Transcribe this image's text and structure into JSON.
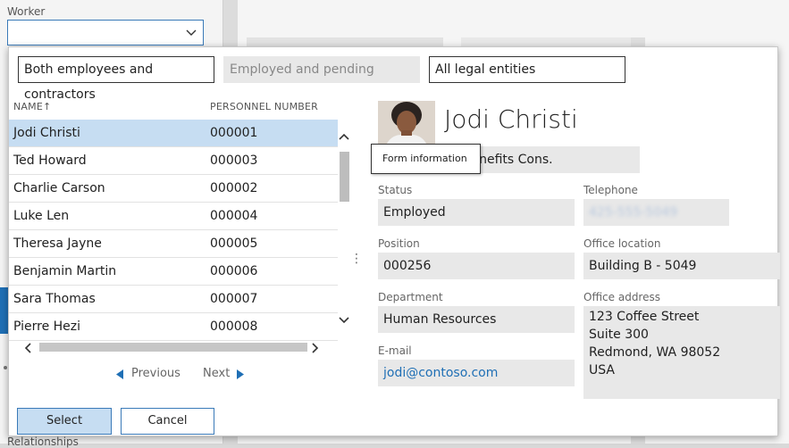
{
  "background": {
    "worker_label": "Worker",
    "bottom_text": "Relationships"
  },
  "filters": {
    "worker_type": "Both employees and contractors",
    "employment_status": "Employed and pending",
    "legal_entity": "All legal entities"
  },
  "grid": {
    "columns": {
      "name": "NAME",
      "name_sort_arrow": "↑",
      "personnel_number": "PERSONNEL NUMBER"
    },
    "rows": [
      {
        "name": "Jodi Christi",
        "number": "000001",
        "selected": true
      },
      {
        "name": "Ted Howard",
        "number": "000003"
      },
      {
        "name": "Charlie Carson",
        "number": "000002"
      },
      {
        "name": "Luke Len",
        "number": "000004"
      },
      {
        "name": "Theresa Jayne",
        "number": "000005"
      },
      {
        "name": "Benjamin Martin",
        "number": "000006"
      },
      {
        "name": "Sara Thomas",
        "number": "000007"
      },
      {
        "name": "Pierre Hezi",
        "number": "000008"
      }
    ]
  },
  "pager": {
    "previous": "Previous",
    "next": "Next"
  },
  "buttons": {
    "select": "Select",
    "cancel": "Cancel"
  },
  "details": {
    "name": "Jodi Christi",
    "job_title": "Compensation & Benefits Cons.",
    "tooltip": "Form information",
    "status_label": "Status",
    "status": "Employed",
    "telephone_label": "Telephone",
    "telephone": "425-555-5049",
    "position_label": "Position",
    "position": "000256",
    "office_location_label": "Office location",
    "office_location": "Building B - 5049",
    "department_label": "Department",
    "department": "Human Resources",
    "office_address_label": "Office address",
    "office_address": [
      "123 Coffee Street",
      "Suite 300",
      "Redmond, WA 98052",
      "USA"
    ],
    "email_label": "E-mail",
    "email": "jodi@contoso.com"
  },
  "colors": {
    "accent": "#1f6fb5",
    "selected_row": "#c6ddf2",
    "field_bg": "#e8e8e8"
  },
  "icons": {
    "worker_dropdown": "chevron-down-icon",
    "scroll_up": "chevron-up-icon",
    "scroll_down": "chevron-down-icon",
    "scroll_left": "chevron-left-icon",
    "scroll_right": "chevron-right-icon",
    "previous": "triangle-left-icon",
    "next": "triangle-right-icon",
    "splitter": "vertical-ellipsis-icon"
  }
}
